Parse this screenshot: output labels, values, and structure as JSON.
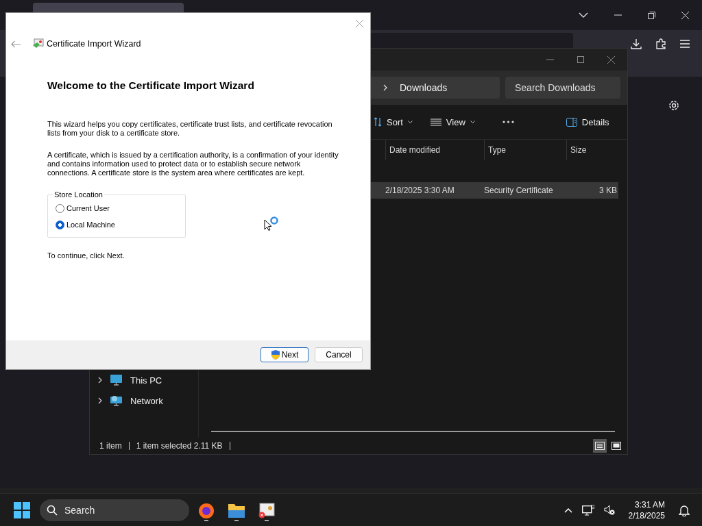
{
  "explorer": {
    "breadcrumb": "Downloads",
    "search": {
      "placeholder": "Search Downloads"
    },
    "toolbar": [
      {
        "kind": "sort",
        "label": "Sort"
      },
      {
        "kind": "view",
        "label": "View"
      },
      {
        "kind": "more"
      },
      {
        "kind": "details",
        "label": "Details"
      }
    ],
    "columns": [
      "Date modified",
      "Type",
      "Size"
    ],
    "rows": [
      {
        "date": "2/18/2025 3:30 AM",
        "type": "Security Certificate",
        "size": "3 KB",
        "selected": true
      }
    ],
    "nav": [
      {
        "kind": "pc",
        "label": "This PC"
      },
      {
        "kind": "network",
        "label": "Network"
      }
    ],
    "status_bar": [
      "1 item",
      "1 item selected  2.11 KB"
    ],
    "view_buttons": [
      {
        "kind": "details",
        "selected": true
      },
      {
        "kind": "tiles",
        "selected": false
      }
    ]
  },
  "wizard": {
    "title": "Certificate Import Wizard",
    "heading": "Welcome to the Certificate Import Wizard",
    "paragraphs": [
      "This wizard helps you copy certificates, certificate trust lists, and certificate revocation lists from your disk to a certificate store.",
      "A certificate, which is issued by a certification authority, is a confirmation of your identity and contains information used to protect data or to establish secure network connections. A certificate store is the system area where certificates are kept."
    ],
    "group_label": "Store Location",
    "radios": [
      {
        "label": "Current User",
        "selected": false
      },
      {
        "label": "Local Machine",
        "selected": true
      }
    ],
    "footer_text": "To continue, click Next.",
    "buttons": [
      {
        "label": "Next",
        "kind": "primary"
      },
      {
        "label": "Cancel",
        "kind": "default"
      }
    ]
  },
  "taskbar": {
    "search": {
      "placeholder": "Search"
    },
    "apps": [
      {
        "kind": "browser"
      },
      {
        "kind": "folder"
      },
      {
        "kind": "certificate"
      }
    ],
    "time": "3:31 AM",
    "date": "2/18/2025"
  }
}
